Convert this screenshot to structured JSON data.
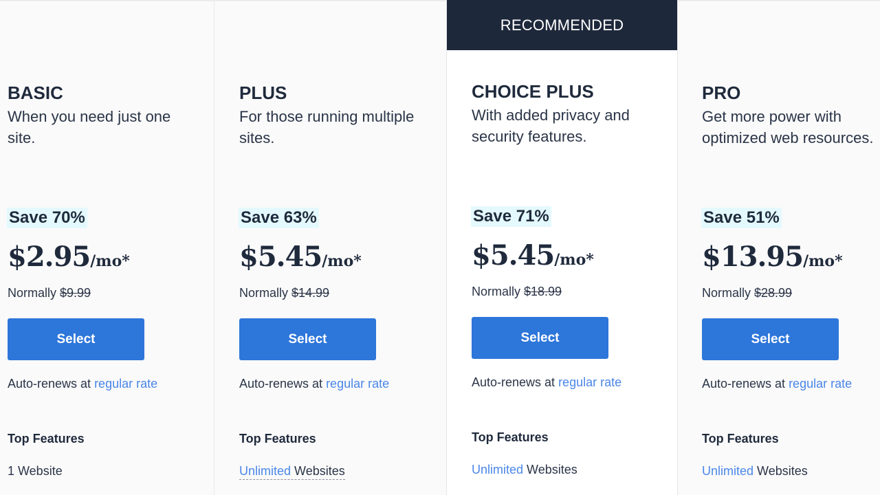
{
  "recommended_label": "RECOMMENDED",
  "common": {
    "select_label": "Select",
    "auto_renews_text": "Auto-renews at ",
    "regular_rate_link": "regular rate",
    "normally_label": "Normally ",
    "per_month": "/mo*",
    "top_features_label": "Top Features"
  },
  "plans": [
    {
      "name": "BASIC",
      "description": "When you need just one site.",
      "save": "Save 70%",
      "price": "$2.95",
      "regular_price": "$9.99",
      "feature_link": "",
      "feature_text": "1 Website",
      "recommended": false
    },
    {
      "name": "PLUS",
      "description": "For those running multiple sites.",
      "save": "Save 63%",
      "price": "$5.45",
      "regular_price": "$14.99",
      "feature_link": "Unlimited",
      "feature_text": " Websites",
      "recommended": false
    },
    {
      "name": "CHOICE PLUS",
      "description": "With added privacy and security features.",
      "save": "Save 71%",
      "price": "$5.45",
      "regular_price": "$18.99",
      "feature_link": "Unlimited",
      "feature_text": " Websites",
      "recommended": true
    },
    {
      "name": "PRO",
      "description": "Get more power with optimized web resources.",
      "save": "Save 51%",
      "price": "$13.95",
      "regular_price": "$28.99",
      "feature_link": "Unlimited",
      "feature_text": " Websites",
      "recommended": false
    }
  ],
  "colors": {
    "primary_button": "#2d76da",
    "banner": "#1e283b",
    "save_highlight": "#e4f9fd",
    "link": "#4a86e8",
    "text": "#1f2a3c"
  }
}
